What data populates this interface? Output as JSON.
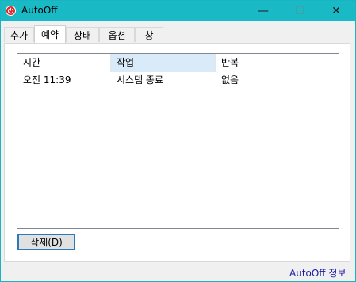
{
  "window": {
    "title": "AutoOff",
    "accent": "#19b9c6",
    "controls": {
      "minimize": "—",
      "maximize": "☐",
      "close": "✕"
    }
  },
  "tabs": [
    {
      "label": "추가"
    },
    {
      "label": "예약",
      "active": true
    },
    {
      "label": "상태"
    },
    {
      "label": "옵션"
    },
    {
      "label": "창"
    }
  ],
  "schedule_list": {
    "columns": [
      "시간",
      "작업",
      "반복"
    ],
    "sorted_column": "작업",
    "rows": [
      [
        "오전 11:39",
        "시스템 종료",
        "없음"
      ]
    ]
  },
  "delete_button": {
    "label": "삭제(D)"
  },
  "about_link": {
    "label": "AutoOff 정보"
  }
}
